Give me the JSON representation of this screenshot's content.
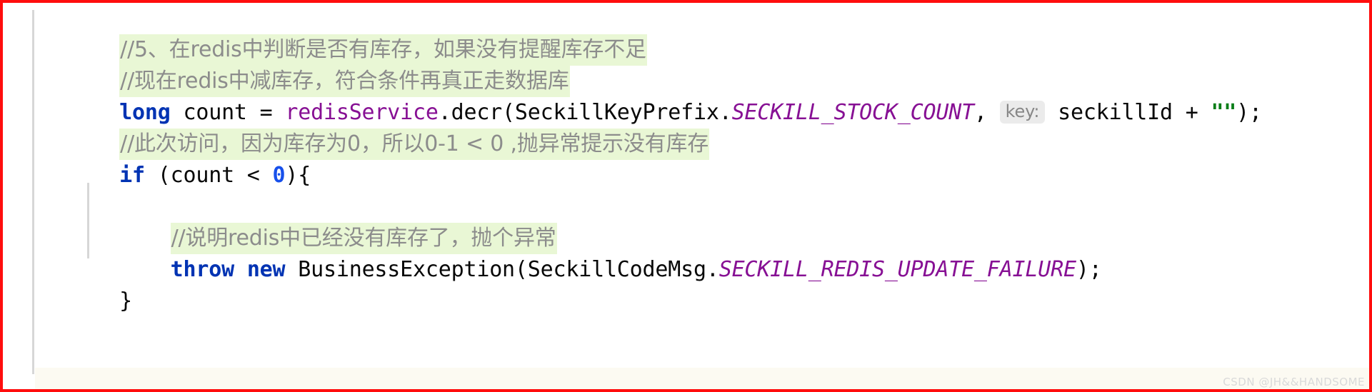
{
  "editor": {
    "language": "Java",
    "colors": {
      "keyword": "#0033b3",
      "number": "#1750eb",
      "field": "#871094",
      "constant": "#871094",
      "string": "#067d17",
      "comment_text": "#8c8c8c",
      "comment_highlight_bg": "#e9f7d5",
      "inlay_hint_bg": "#ebebeb",
      "inlay_hint_text": "#878787",
      "caret_row_bg": "#fcfaf2",
      "indent_guide": "#d7d7d7",
      "annotation_border": "#ff0d0d",
      "background": "#ffffff"
    },
    "lines": [
      {
        "id": "line-comment-1",
        "type": "comment",
        "text": "//5、在redis中判断是否有库存，如果没有提醒库存不足"
      },
      {
        "id": "line-comment-2",
        "type": "comment",
        "text": "//现在redis中减库存，符合条件再真正走数据库"
      },
      {
        "id": "line-decr-call",
        "type": "code",
        "tokens": [
          {
            "t": "long",
            "k": "keyword"
          },
          {
            "t": " count = ",
            "k": "plain"
          },
          {
            "t": "redisService",
            "k": "field"
          },
          {
            "t": ".decr(SeckillKeyPrefix.",
            "k": "plain"
          },
          {
            "t": "SECKILL_STOCK_COUNT",
            "k": "constant"
          },
          {
            "t": ", ",
            "k": "plain"
          },
          {
            "t": "key:",
            "k": "hint"
          },
          {
            "t": " seckillId + ",
            "k": "plain"
          },
          {
            "t": "\"\"",
            "k": "string"
          },
          {
            "t": ");",
            "k": "plain"
          }
        ]
      },
      {
        "id": "line-comment-3",
        "type": "comment",
        "text": "//此次访问，因为库存为0，所以0-1 < 0 ,抛异常提示没有库存"
      },
      {
        "id": "line-if",
        "type": "code",
        "tokens": [
          {
            "t": "if",
            "k": "keyword"
          },
          {
            "t": " (count < ",
            "k": "plain"
          },
          {
            "t": "0",
            "k": "number"
          },
          {
            "t": "){",
            "k": "plain"
          }
        ]
      },
      {
        "id": "line-blank",
        "type": "blank",
        "text": ""
      },
      {
        "id": "line-comment-4",
        "type": "comment",
        "indent": "    ",
        "text": "//说明redis中已经没有库存了，抛个异常"
      },
      {
        "id": "line-throw",
        "type": "code",
        "indent": "    ",
        "tokens": [
          {
            "t": "throw",
            "k": "keyword"
          },
          {
            "t": " ",
            "k": "plain"
          },
          {
            "t": "new",
            "k": "keyword"
          },
          {
            "t": " BusinessException(SeckillCodeMsg.",
            "k": "plain"
          },
          {
            "t": "SECKILL_REDIS_UPDATE_FAILURE",
            "k": "constant"
          },
          {
            "t": ");",
            "k": "plain"
          }
        ]
      },
      {
        "id": "line-close-brace",
        "type": "code",
        "tokens": [
          {
            "t": "}",
            "k": "plain"
          }
        ]
      }
    ]
  },
  "watermark": {
    "text": "CSDN @JH&&HANDSOME"
  }
}
